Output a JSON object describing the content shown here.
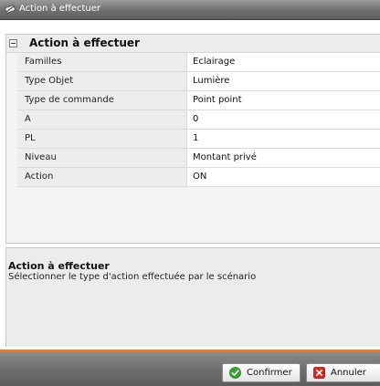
{
  "window": {
    "title": "Action à effectuer"
  },
  "grid": {
    "section_title": "Action à effectuer",
    "rows": [
      {
        "name": "Familles",
        "value": "Eclairage"
      },
      {
        "name": "Type Objet",
        "value": "Lumière"
      },
      {
        "name": "Type de commande",
        "value": "Point point"
      },
      {
        "name": "A",
        "value": "0"
      },
      {
        "name": "PL",
        "value": "1"
      },
      {
        "name": "Niveau",
        "value": "Montant privé"
      },
      {
        "name": "Action",
        "value": "ON"
      }
    ]
  },
  "help": {
    "title": "Action à effectuer",
    "description": "Sélectionner le type d'action effectuée par le scénario"
  },
  "buttons": {
    "confirm_label": "Confirmer",
    "cancel_label": "Annuler"
  },
  "colors": {
    "accent": "#f07a22",
    "confirm_icon": "#3aa334",
    "cancel_icon": "#d62a1f"
  },
  "icons": {
    "title": "wand-icon",
    "confirm": "check-circle-icon",
    "cancel": "close-box-icon"
  }
}
